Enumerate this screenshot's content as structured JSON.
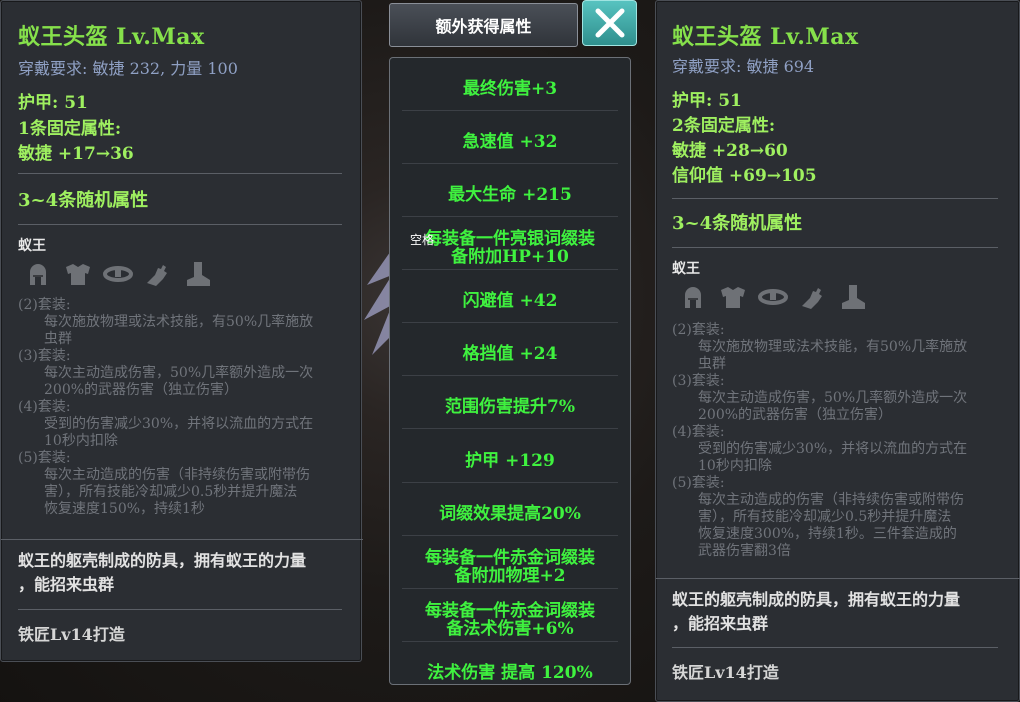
{
  "left": {
    "title": "蚁王头盔  Lv.Max",
    "requirement": "穿戴要求:  敏捷  232, 力量  100",
    "armor": "护甲:   51",
    "fixed_header": "1条固定属性:",
    "fixed": [
      "敏捷  +17→36"
    ],
    "random_header": "3~4条随机属性",
    "set_name": "蚁王",
    "set_bonuses": [
      {
        "label": "(2)套装:",
        "text": [
          "每次施放物理或法术技能，有50%几率施放",
          "虫群"
        ]
      },
      {
        "label": "(3)套装:",
        "text": [
          "每次主动造成伤害，50%几率额外造成一次",
          "200%的武器伤害（独立伤害）"
        ]
      },
      {
        "label": "(4)套装:",
        "text": [
          "受到的伤害减少30%，并将以流血的方式在",
          "10秒内扣除"
        ]
      },
      {
        "label": "(5)套装:",
        "text": [
          "每次主动造成的伤害（非持续伤害或附带伤",
          "害），所有技能冷却减少0.5秒并提升魔法",
          "恢复速度150%，持续1秒"
        ]
      }
    ],
    "description": [
      "蚁王的躯壳制成的防具，拥有蚁王的力量",
      "，能招来虫群"
    ],
    "crafter": "铁匠Lv14打造"
  },
  "right": {
    "title": "蚁王头盔  Lv.Max",
    "requirement": "穿戴要求:  敏捷  694",
    "armor": "护甲:   51",
    "fixed_header": "2条固定属性:",
    "fixed": [
      "敏捷  +28→60",
      "信仰值  +69→105"
    ],
    "random_header": "3~4条随机属性",
    "set_name": "蚁王",
    "set_bonuses": [
      {
        "label": "(2)套装:",
        "text": [
          "每次施放物理或法术技能，有50%几率施放",
          "虫群"
        ]
      },
      {
        "label": "(3)套装:",
        "text": [
          "每次主动造成伤害，50%几率额外造成一次",
          "200%的武器伤害（独立伤害）"
        ]
      },
      {
        "label": "(4)套装:",
        "text": [
          "受到的伤害减少30%，并将以流血的方式在",
          "10秒内扣除"
        ]
      },
      {
        "label": "(5)套装:",
        "text": [
          "每次主动造成的伤害（非持续伤害或附带伤",
          "害），所有技能冷却减少0.5秒并提升魔法",
          "恢复速度300%，持续1秒。三件套造成的",
          "武器伤害翻3倍"
        ]
      }
    ],
    "description": [
      "蚁王的躯壳制成的防具，拥有蚁王的力量",
      "，能招来虫群"
    ],
    "crafter": "铁匠Lv14打造"
  },
  "middle": {
    "header": "额外获得属性",
    "space_hint": "空格",
    "items": [
      [
        "最终伤害+3"
      ],
      [
        "急速值  +32"
      ],
      [
        "最大生命  +215"
      ],
      [
        "每装备一件亮银词缀装",
        "备附加HP+10"
      ],
      [
        "闪避值  +42"
      ],
      [
        "格挡值  +24"
      ],
      [
        "范围伤害提升7%"
      ],
      [
        "护甲  +129"
      ],
      [
        "词缀效果提高20%"
      ],
      [
        "每装备一件赤金词缀装",
        "备附加物理+2"
      ],
      [
        "每装备一件赤金词缀装",
        "备法术伤害+6%"
      ],
      [
        "法术伤害  提高  120%"
      ]
    ]
  },
  "set_icons": [
    "helmet-icon",
    "chest-armor-icon",
    "belt-icon",
    "gauntlet-icon",
    "boots-icon"
  ],
  "colors": {
    "title": "#86e14b",
    "stat": "#9ff060",
    "bonus": "#3ff23f",
    "inactive": "#70747b",
    "close": "#3aa8a5"
  }
}
